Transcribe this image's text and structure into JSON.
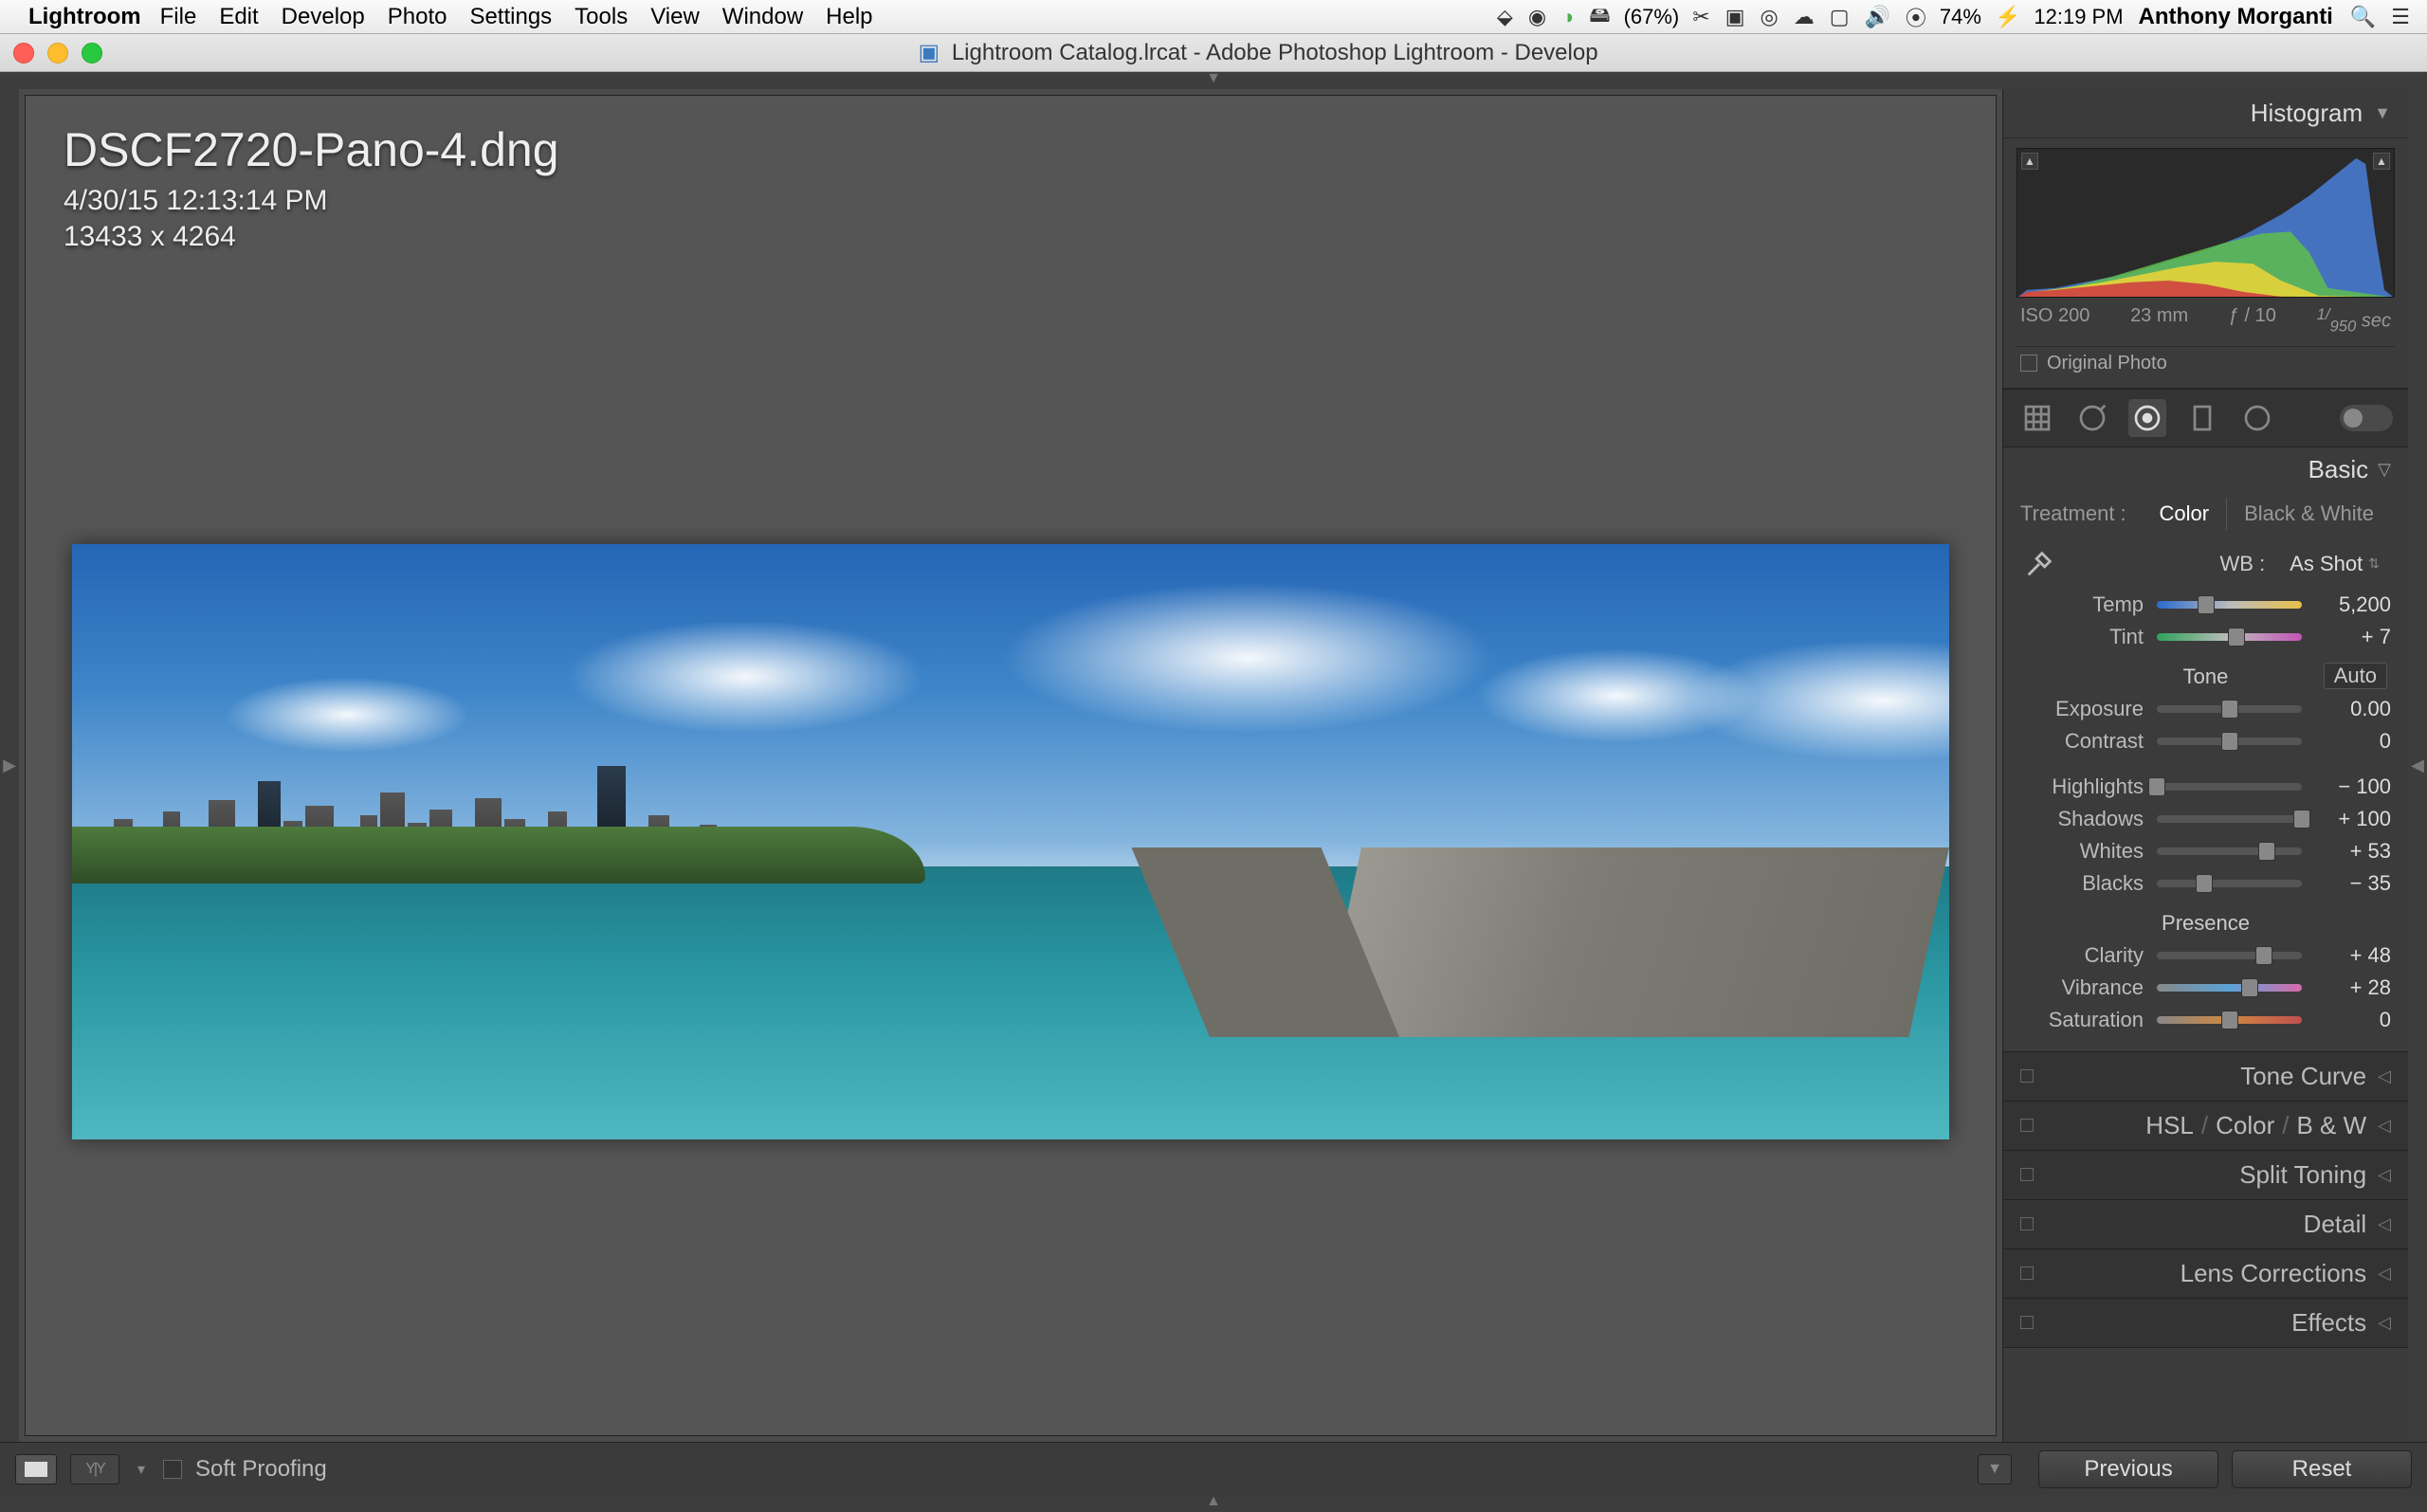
{
  "menubar": {
    "app": "Lightroom",
    "items": [
      "File",
      "Edit",
      "Develop",
      "Photo",
      "Settings",
      "Tools",
      "View",
      "Window",
      "Help"
    ],
    "battery1": "(67%)",
    "battery2": "74%",
    "clock": "12:19 PM",
    "user": "Anthony Morganti"
  },
  "window": {
    "title": "Lightroom Catalog.lrcat - Adobe Photoshop Lightroom - Develop"
  },
  "image": {
    "filename": "DSCF2720-Pano-4.dng",
    "datetime": "4/30/15 12:13:14 PM",
    "dimensions": "13433 x 4264"
  },
  "histogram": {
    "title": "Histogram",
    "iso": "ISO 200",
    "focal": "23 mm",
    "aperture": "ƒ / 10",
    "shutter_prefix": "1/",
    "shutter_val": "950",
    "shutter_suffix": " sec",
    "original_label": "Original Photo"
  },
  "basic": {
    "title": "Basic",
    "treatment_label": "Treatment :",
    "treatment_color": "Color",
    "treatment_bw": "Black & White",
    "wb_label": "WB :",
    "wb_value": "As Shot",
    "tone_label": "Tone",
    "auto_label": "Auto",
    "presence_label": "Presence",
    "sliders": {
      "temp": {
        "label": "Temp",
        "value": "5,200",
        "pos": 34
      },
      "tint": {
        "label": "Tint",
        "value": "+ 7",
        "pos": 55
      },
      "exposure": {
        "label": "Exposure",
        "value": "0.00",
        "pos": 50
      },
      "contrast": {
        "label": "Contrast",
        "value": "0",
        "pos": 50
      },
      "highlights": {
        "label": "Highlights",
        "value": "− 100",
        "pos": 0
      },
      "shadows": {
        "label": "Shadows",
        "value": "+ 100",
        "pos": 100
      },
      "whites": {
        "label": "Whites",
        "value": "+ 53",
        "pos": 76
      },
      "blacks": {
        "label": "Blacks",
        "value": "− 35",
        "pos": 33
      },
      "clarity": {
        "label": "Clarity",
        "value": "+ 48",
        "pos": 74
      },
      "vibrance": {
        "label": "Vibrance",
        "value": "+ 28",
        "pos": 64
      },
      "saturation": {
        "label": "Saturation",
        "value": "0",
        "pos": 50
      }
    }
  },
  "panels": {
    "tonecurve": "Tone Curve",
    "hsl": "HSL",
    "color": "Color",
    "bw": "B & W",
    "split": "Split Toning",
    "detail": "Detail",
    "lens": "Lens Corrections",
    "effects": "Effects"
  },
  "bottom": {
    "softproof": "Soft Proofing",
    "previous": "Previous",
    "reset": "Reset"
  }
}
